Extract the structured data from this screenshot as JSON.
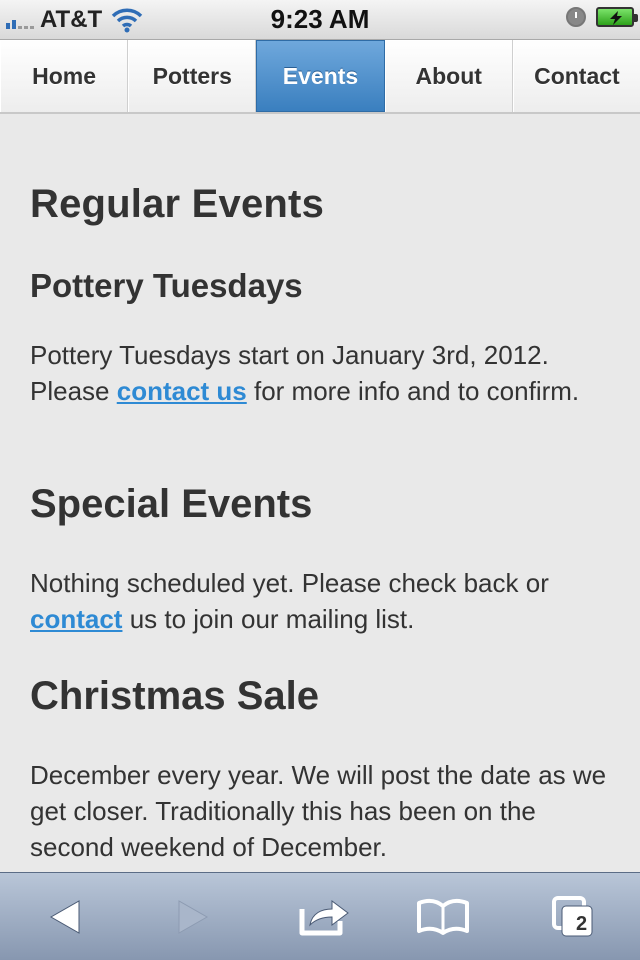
{
  "status_bar": {
    "carrier": "AT&T",
    "time": "9:23 AM",
    "icons": [
      "signal-icon",
      "wifi-icon",
      "alarm-clock-icon",
      "battery-charging-icon"
    ]
  },
  "nav": {
    "tabs": [
      {
        "label": "Home",
        "active": false
      },
      {
        "label": "Potters",
        "active": false
      },
      {
        "label": "Events",
        "active": true
      },
      {
        "label": "About",
        "active": false
      },
      {
        "label": "Contact",
        "active": false
      }
    ]
  },
  "content": {
    "title": "Regular Events",
    "sections": [
      {
        "heading": "Pottery Tuesdays",
        "text_before": "Pottery Tuesdays start on January 3rd, 2012. Please ",
        "link": "contact us",
        "text_after": " for more info and to confirm."
      },
      {
        "heading": "Special Events",
        "text_before": "Nothing scheduled yet. Please check back or ",
        "link": "contact",
        "text_after": " us to join our mailing list."
      },
      {
        "heading": "Christmas Sale",
        "text": "December every year. We will post the date as we get closer. Traditionally this has been on the second weekend of December."
      }
    ]
  },
  "toolbar": {
    "buttons": [
      "back-arrow-icon",
      "forward-arrow-icon",
      "share-icon",
      "bookmarks-book-icon",
      "pages-icon"
    ],
    "pages_count": "2"
  },
  "colors": {
    "nav_active": "#4a8fcf",
    "link": "#2e8ad4",
    "background": "#e9e9e9",
    "toolbar": "#9aa8be"
  }
}
